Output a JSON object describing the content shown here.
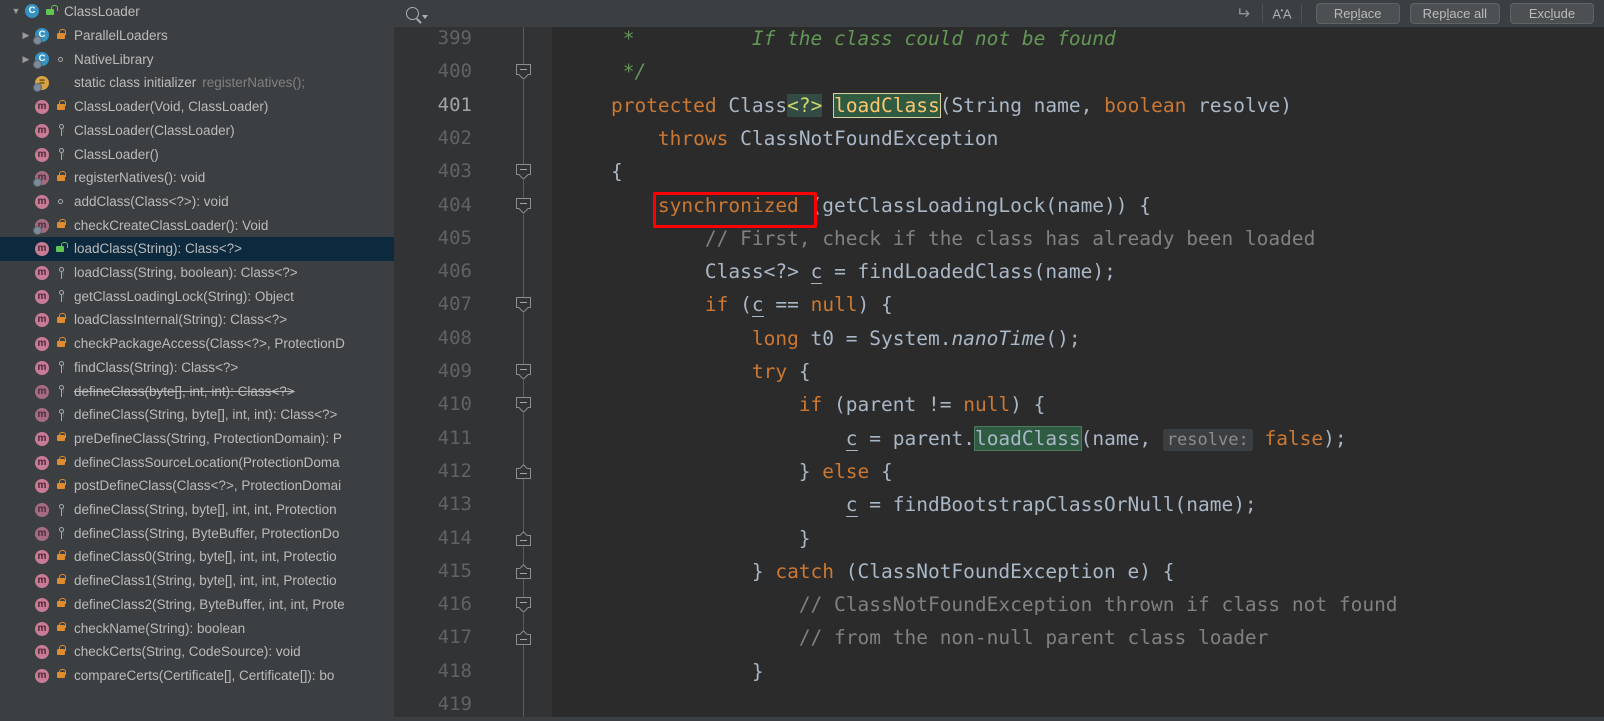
{
  "structure": {
    "panel_name": "Structure",
    "items": [
      {
        "depth": 0,
        "arrow": "open",
        "icon": "class-icon",
        "vis": "public",
        "label": "ClassLoader",
        "extra": "",
        "selected": false,
        "struck": false
      },
      {
        "depth": 1,
        "arrow": "closed",
        "icon": "class-icon-static",
        "vis": "protected",
        "label": "ParallelLoaders",
        "extra": "",
        "selected": false,
        "struck": false
      },
      {
        "depth": 1,
        "arrow": "closed",
        "icon": "class-icon-static",
        "vis": "package",
        "label": "NativeLibrary",
        "extra": "",
        "selected": false,
        "struck": false
      },
      {
        "depth": 1,
        "arrow": "none",
        "icon": "static-initializer-icon",
        "vis": "none",
        "label": "static class initializer",
        "extra": "registerNatives();",
        "selected": false,
        "struck": false
      },
      {
        "depth": 1,
        "arrow": "none",
        "icon": "method-icon",
        "vis": "protected",
        "label": "ClassLoader(Void, ClassLoader)",
        "extra": "",
        "selected": false,
        "struck": false
      },
      {
        "depth": 1,
        "arrow": "none",
        "icon": "method-icon",
        "vis": "private",
        "label": "ClassLoader(ClassLoader)",
        "extra": "",
        "selected": false,
        "struck": false
      },
      {
        "depth": 1,
        "arrow": "none",
        "icon": "method-icon",
        "vis": "private",
        "label": "ClassLoader()",
        "extra": "",
        "selected": false,
        "struck": false
      },
      {
        "depth": 1,
        "arrow": "none",
        "icon": "method-icon-static",
        "vis": "protected",
        "label": "registerNatives(): void",
        "extra": "",
        "selected": false,
        "struck": false
      },
      {
        "depth": 1,
        "arrow": "none",
        "icon": "method-icon",
        "vis": "package",
        "label": "addClass(Class<?>): void",
        "extra": "",
        "selected": false,
        "struck": false
      },
      {
        "depth": 1,
        "arrow": "none",
        "icon": "method-icon-static",
        "vis": "protected",
        "label": "checkCreateClassLoader(): Void",
        "extra": "",
        "selected": false,
        "struck": false
      },
      {
        "depth": 1,
        "arrow": "none",
        "icon": "method-icon",
        "vis": "public",
        "label": "loadClass(String): Class<?>",
        "extra": "",
        "selected": true,
        "struck": false
      },
      {
        "depth": 1,
        "arrow": "none",
        "icon": "method-icon",
        "vis": "private",
        "label": "loadClass(String, boolean): Class<?>",
        "extra": "",
        "selected": false,
        "struck": false
      },
      {
        "depth": 1,
        "arrow": "none",
        "icon": "method-icon",
        "vis": "private",
        "label": "getClassLoadingLock(String): Object",
        "extra": "",
        "selected": false,
        "struck": false
      },
      {
        "depth": 1,
        "arrow": "none",
        "icon": "method-icon",
        "vis": "protected",
        "label": "loadClassInternal(String): Class<?>",
        "extra": "",
        "selected": false,
        "struck": false
      },
      {
        "depth": 1,
        "arrow": "none",
        "icon": "method-icon",
        "vis": "protected",
        "label": "checkPackageAccess(Class<?>, ProtectionD",
        "extra": "",
        "selected": false,
        "struck": false
      },
      {
        "depth": 1,
        "arrow": "none",
        "icon": "method-icon",
        "vis": "private",
        "label": "findClass(String): Class<?>",
        "extra": "",
        "selected": false,
        "struck": false
      },
      {
        "depth": 1,
        "arrow": "none",
        "icon": "method-icon-deprecated",
        "vis": "private",
        "label": "defineClass(byte[], int, int): Class<?>",
        "extra": "",
        "selected": false,
        "struck": true
      },
      {
        "depth": 1,
        "arrow": "none",
        "icon": "method-icon-deprecated",
        "vis": "private",
        "label": "defineClass(String, byte[], int, int): Class<?>",
        "extra": "",
        "selected": false,
        "struck": false
      },
      {
        "depth": 1,
        "arrow": "none",
        "icon": "method-icon",
        "vis": "protected",
        "label": "preDefineClass(String, ProtectionDomain): P",
        "extra": "",
        "selected": false,
        "struck": false
      },
      {
        "depth": 1,
        "arrow": "none",
        "icon": "method-icon",
        "vis": "protected",
        "label": "defineClassSourceLocation(ProtectionDoma",
        "extra": "",
        "selected": false,
        "struck": false
      },
      {
        "depth": 1,
        "arrow": "none",
        "icon": "method-icon",
        "vis": "protected",
        "label": "postDefineClass(Class<?>, ProtectionDomai",
        "extra": "",
        "selected": false,
        "struck": false
      },
      {
        "depth": 1,
        "arrow": "none",
        "icon": "method-icon-deprecated",
        "vis": "private",
        "label": "defineClass(String, byte[], int, int, Protection",
        "extra": "",
        "selected": false,
        "struck": false
      },
      {
        "depth": 1,
        "arrow": "none",
        "icon": "method-icon-deprecated",
        "vis": "private",
        "label": "defineClass(String, ByteBuffer, ProtectionDo",
        "extra": "",
        "selected": false,
        "struck": false
      },
      {
        "depth": 1,
        "arrow": "none",
        "icon": "method-icon",
        "vis": "protected",
        "label": "defineClass0(String, byte[], int, int, Protectio",
        "extra": "",
        "selected": false,
        "struck": false
      },
      {
        "depth": 1,
        "arrow": "none",
        "icon": "method-icon",
        "vis": "protected",
        "label": "defineClass1(String, byte[], int, int, Protectio",
        "extra": "",
        "selected": false,
        "struck": false
      },
      {
        "depth": 1,
        "arrow": "none",
        "icon": "method-icon",
        "vis": "protected",
        "label": "defineClass2(String, ByteBuffer, int, int, Prote",
        "extra": "",
        "selected": false,
        "struck": false
      },
      {
        "depth": 1,
        "arrow": "none",
        "icon": "method-icon",
        "vis": "protected",
        "label": "checkName(String): boolean",
        "extra": "",
        "selected": false,
        "struck": false
      },
      {
        "depth": 1,
        "arrow": "none",
        "icon": "method-icon",
        "vis": "protected",
        "label": "checkCerts(String, CodeSource): void",
        "extra": "",
        "selected": false,
        "struck": false
      },
      {
        "depth": 1,
        "arrow": "none",
        "icon": "method-icon",
        "vis": "protected",
        "label": "compareCerts(Certificate[], Certificate[]): bo",
        "extra": "",
        "selected": false,
        "struck": false
      }
    ]
  },
  "find_toolbar": {
    "search_placeholder": "",
    "search_value": "",
    "search_icon": "search-icon",
    "multiline_icon": "multiline-toggle-icon",
    "match_case_icon": "match-case-icon",
    "buttons": [
      {
        "name": "replace-button",
        "pre": "Rep",
        "mn": "l",
        "post": "ace"
      },
      {
        "name": "replace-all-button",
        "pre": "Rep",
        "mn": "l",
        "post": "ace all"
      },
      {
        "name": "exclude-button",
        "pre": "Exc",
        "mn": "l",
        "post": "ude"
      }
    ]
  },
  "editor": {
    "first_visible_line": 399,
    "current_line": 401,
    "run_gutter_line": 401,
    "annotation_box": {
      "label": "synchronized-highlight-box",
      "color": "#ff0000"
    },
    "lines": [
      {
        "no": "399",
        "fold": "none"
      },
      {
        "no": "400",
        "fold": "down"
      },
      {
        "no": "401",
        "fold": "none",
        "current": true,
        "run": true
      },
      {
        "no": "402",
        "fold": "none"
      },
      {
        "no": "403",
        "fold": "down"
      },
      {
        "no": "404",
        "fold": "down"
      },
      {
        "no": "405",
        "fold": "none"
      },
      {
        "no": "406",
        "fold": "none"
      },
      {
        "no": "407",
        "fold": "down"
      },
      {
        "no": "408",
        "fold": "none"
      },
      {
        "no": "409",
        "fold": "down"
      },
      {
        "no": "410",
        "fold": "down"
      },
      {
        "no": "411",
        "fold": "none"
      },
      {
        "no": "412",
        "fold": "up"
      },
      {
        "no": "413",
        "fold": "none"
      },
      {
        "no": "414",
        "fold": "up"
      },
      {
        "no": "415",
        "fold": "up"
      },
      {
        "no": "416",
        "fold": "down"
      },
      {
        "no": "417",
        "fold": "up"
      },
      {
        "no": "418",
        "fold": "none"
      },
      {
        "no": "419",
        "fold": "none"
      }
    ],
    "code_text": [
      "     *          If the class could not be found",
      "     */",
      "    protected Class<?> loadClass(String name, boolean resolve)",
      "        throws ClassNotFoundException",
      "    {",
      "        synchronized (getClassLoadingLock(name)) {",
      "            // First, check if the class has already been loaded",
      "            Class<?> c = findLoadedClass(name);",
      "            if (c == null) {",
      "                long t0 = System.nanoTime();",
      "                try {",
      "                    if (parent != null) {",
      "                        c = parent.loadClass(name,  resolve: false);",
      "                    } else {",
      "                        c = findBootstrapClassOrNull(name);",
      "                    }",
      "                } catch (ClassNotFoundException e) {",
      "                    // ClassNotFoundException thrown if class not found",
      "                    // from the non-null parent class loader",
      "                }"
    ],
    "inlay_hints": [
      {
        "line": 411,
        "text": "resolve:"
      }
    ],
    "search_match_text": "loadClass",
    "colors": {
      "background": "#2b2b2b",
      "gutter": "#313335",
      "panel": "#3c3f41",
      "selection": "#0d293e",
      "keyword": "#cc7832",
      "string": "#6a8759",
      "comment": "#808080",
      "javadoc": "#629755",
      "number": "#6897bb",
      "identifier": "#a9b7c6",
      "method_name": "#ffc66d",
      "match_highlight": "#2f5b43",
      "annotation_red": "#ff0000"
    }
  }
}
